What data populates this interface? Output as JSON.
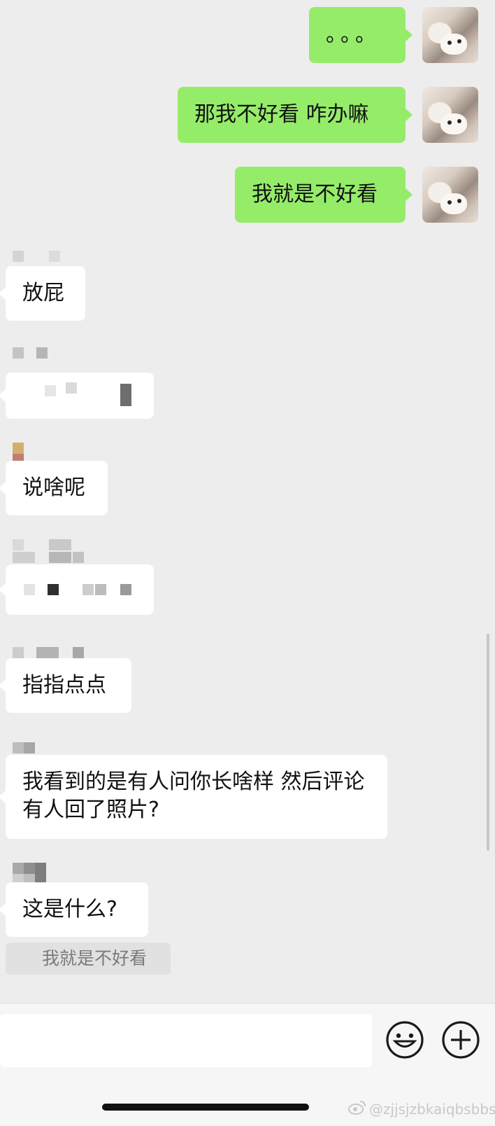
{
  "messages": {
    "out_1": "。。。",
    "out_2": "那我不好看 咋办嘛",
    "out_3": "我就是不好看",
    "in_1": "放屁",
    "in_3": "说啥呢",
    "in_5": "指指点点",
    "in_6": "我看到的是有人问你长啥样 然后评论有人回了照片?",
    "in_7": "这是什么?"
  },
  "quote": {
    "text": "我就是不好看"
  },
  "input": {
    "placeholder": ""
  },
  "icons": {
    "emoji": "emoji-icon",
    "plus": "plus-icon",
    "weibo": "weibo-logo-icon"
  },
  "watermark": {
    "text": "@zjjsjzbkaiqbsbbsij"
  },
  "colors": {
    "outgoing": "#95ec69",
    "incoming": "#ffffff",
    "background": "#ededed"
  }
}
